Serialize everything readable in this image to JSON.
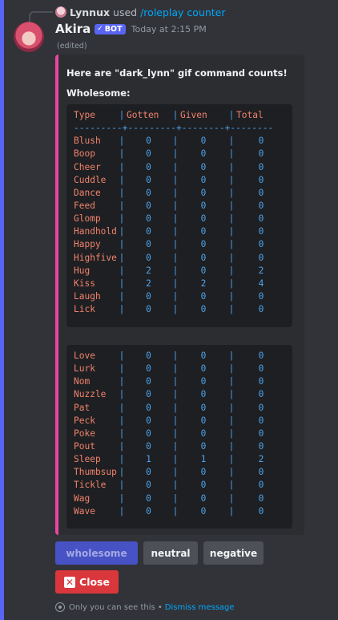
{
  "reply": {
    "user": "Lynnux",
    "used_text": "used",
    "command": "/roleplay counter"
  },
  "message": {
    "author": "Akira",
    "badge": "BOT",
    "timestamp": "Today at 2:15 PM",
    "edited": "(edited)"
  },
  "embed": {
    "color": "#eb459e",
    "intro": "Here are \"dark_lynn\" gif command counts!",
    "section": "Wholesome:",
    "table": {
      "headers": [
        "Type",
        "Gotten",
        "Given",
        "Total"
      ],
      "separator": "---------+---------+--------+--------",
      "rows_part1": [
        [
          "Blush",
          "0",
          "0",
          "0"
        ],
        [
          "Boop",
          "0",
          "0",
          "0"
        ],
        [
          "Cheer",
          "0",
          "0",
          "0"
        ],
        [
          "Cuddle",
          "0",
          "0",
          "0"
        ],
        [
          "Dance",
          "0",
          "0",
          "0"
        ],
        [
          "Feed",
          "0",
          "0",
          "0"
        ],
        [
          "Glomp",
          "0",
          "0",
          "0"
        ],
        [
          "Handhold",
          "0",
          "0",
          "0"
        ],
        [
          "Happy",
          "0",
          "0",
          "0"
        ],
        [
          "Highfive",
          "0",
          "0",
          "0"
        ],
        [
          "Hug",
          "2",
          "0",
          "2"
        ],
        [
          "Kiss",
          "2",
          "2",
          "4"
        ],
        [
          "Laugh",
          "0",
          "0",
          "0"
        ],
        [
          "Lick",
          "0",
          "0",
          "0"
        ]
      ],
      "rows_part2": [
        [
          "Love",
          "0",
          "0",
          "0"
        ],
        [
          "Lurk",
          "0",
          "0",
          "0"
        ],
        [
          "Nom",
          "0",
          "0",
          "0"
        ],
        [
          "Nuzzle",
          "0",
          "0",
          "0"
        ],
        [
          "Pat",
          "0",
          "0",
          "0"
        ],
        [
          "Peck",
          "0",
          "0",
          "0"
        ],
        [
          "Poke",
          "0",
          "0",
          "0"
        ],
        [
          "Pout",
          "0",
          "0",
          "0"
        ],
        [
          "Sleep",
          "1",
          "1",
          "2"
        ],
        [
          "Thumbsup",
          "0",
          "0",
          "0"
        ],
        [
          "Tickle",
          "0",
          "0",
          "0"
        ],
        [
          "Wag",
          "0",
          "0",
          "0"
        ],
        [
          "Wave",
          "0",
          "0",
          "0"
        ]
      ]
    }
  },
  "buttons": {
    "wholesome": "wholesome",
    "neutral": "neutral",
    "negative": "negative",
    "close": "Close"
  },
  "footer": {
    "ephemeral": "Only you can see this •",
    "dismiss": "Dismiss message"
  }
}
